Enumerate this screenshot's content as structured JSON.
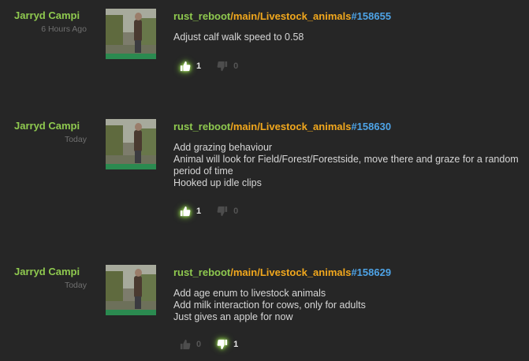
{
  "colors": {
    "background": "#262626",
    "author": "#8fc94f",
    "repo": "#8fc94f",
    "branch": "#f2a81d",
    "changeset": "#4ea3e6",
    "message": "#d6d6d6",
    "active_vote_glow": "#7fcc3a"
  },
  "commits": [
    {
      "author": "Jarryd Campi",
      "time": "6 Hours Ago",
      "repo": "rust_reboot",
      "sep1": "/",
      "branch_main": "main",
      "sep2": "/",
      "branch_sub": "Livestock_animals",
      "changeset": "#158655",
      "message": [
        "Adjust calf walk speed to 0.58"
      ],
      "likes": "1",
      "dislikes": "0",
      "liked": true,
      "disliked": false
    },
    {
      "author": "Jarryd Campi",
      "time": "Today",
      "repo": "rust_reboot",
      "sep1": "/",
      "branch_main": "main",
      "sep2": "/",
      "branch_sub": "Livestock_animals",
      "changeset": "#158630",
      "message": [
        "Add grazing behaviour",
        "Animal will look for Field/Forest/Forestside, move there and graze for a random period of time",
        "Hooked up idle clips"
      ],
      "likes": "1",
      "dislikes": "0",
      "liked": true,
      "disliked": false
    },
    {
      "author": "Jarryd Campi",
      "time": "Today",
      "repo": "rust_reboot",
      "sep1": "/",
      "branch_main": "main",
      "sep2": "/",
      "branch_sub": "Livestock_animals",
      "changeset": "#158629",
      "message": [
        "Add age enum to livestock animals",
        "Add milk interaction for cows, only for adults",
        "Just gives an apple for now"
      ],
      "likes": "0",
      "dislikes": "1",
      "liked": false,
      "disliked": true
    }
  ]
}
